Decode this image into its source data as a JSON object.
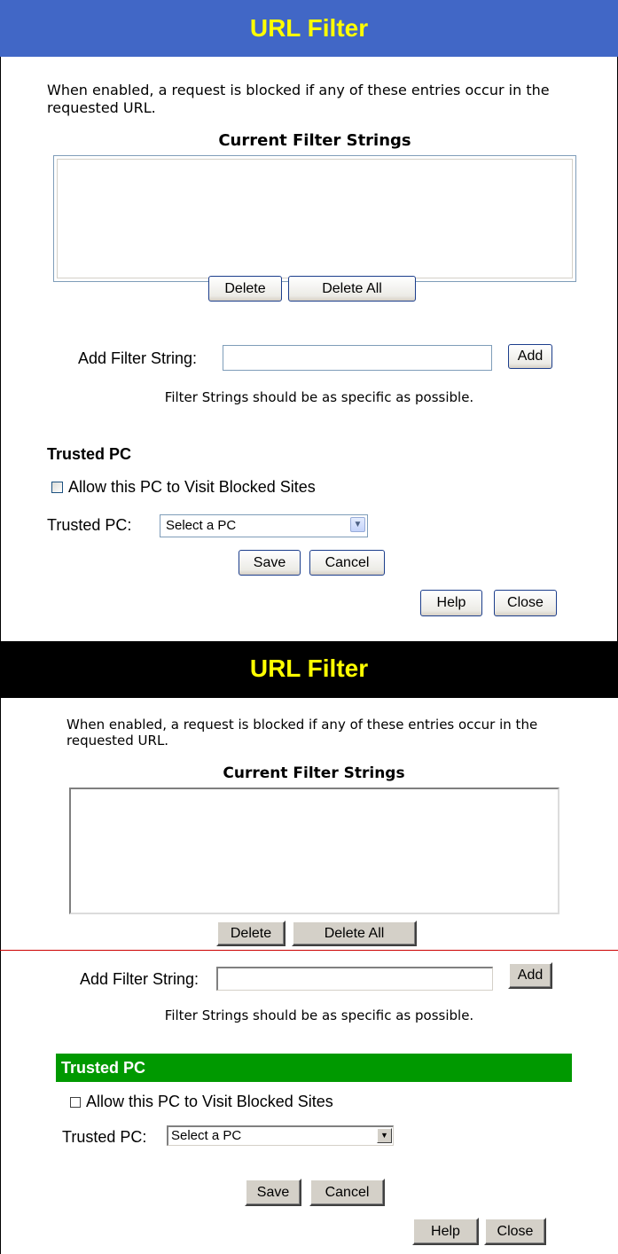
{
  "top": {
    "title": "URL Filter",
    "intro": "When enabled, a request is blocked if any of these entries occur in the requested URL.",
    "filter_list_heading": "Current Filter Strings",
    "delete_label": "Delete",
    "delete_all_label": "Delete All",
    "add_filter_label": "Add Filter String:",
    "add_filter_value": "",
    "add_label": "Add",
    "hint": "Filter Strings should be as specific as possible.",
    "trusted_heading": "Trusted PC",
    "allow_label": "Allow this PC to Visit Blocked Sites",
    "trusted_pc_label": "Trusted PC:",
    "trusted_pc_selected": "Select a PC",
    "save_label": "Save",
    "cancel_label": "Cancel",
    "help_label": "Help",
    "close_label": "Close",
    "title_bar_color": "#4167c6",
    "title_text_color": "#ffff00"
  },
  "bottom": {
    "title": "URL Filter",
    "intro": "When enabled, a request is blocked if any of these entries occur in the requested URL.",
    "filter_list_heading": "Current Filter Strings",
    "delete_label": "Delete",
    "delete_all_label": "Delete All",
    "add_filter_label": "Add Filter String:",
    "add_filter_value": "",
    "add_label": "Add",
    "hint": "Filter Strings should be as specific as possible.",
    "trusted_heading": "Trusted PC",
    "allow_label": "Allow this PC to Visit Blocked Sites",
    "trusted_pc_label": "Trusted PC:",
    "trusted_pc_selected": "Select a PC",
    "save_label": "Save",
    "cancel_label": "Cancel",
    "help_label": "Help",
    "close_label": "Close",
    "title_bar_color": "#000000",
    "title_text_color": "#ffff00",
    "trusted_bar_color": "#009900",
    "divider_color": "#cc0000"
  }
}
